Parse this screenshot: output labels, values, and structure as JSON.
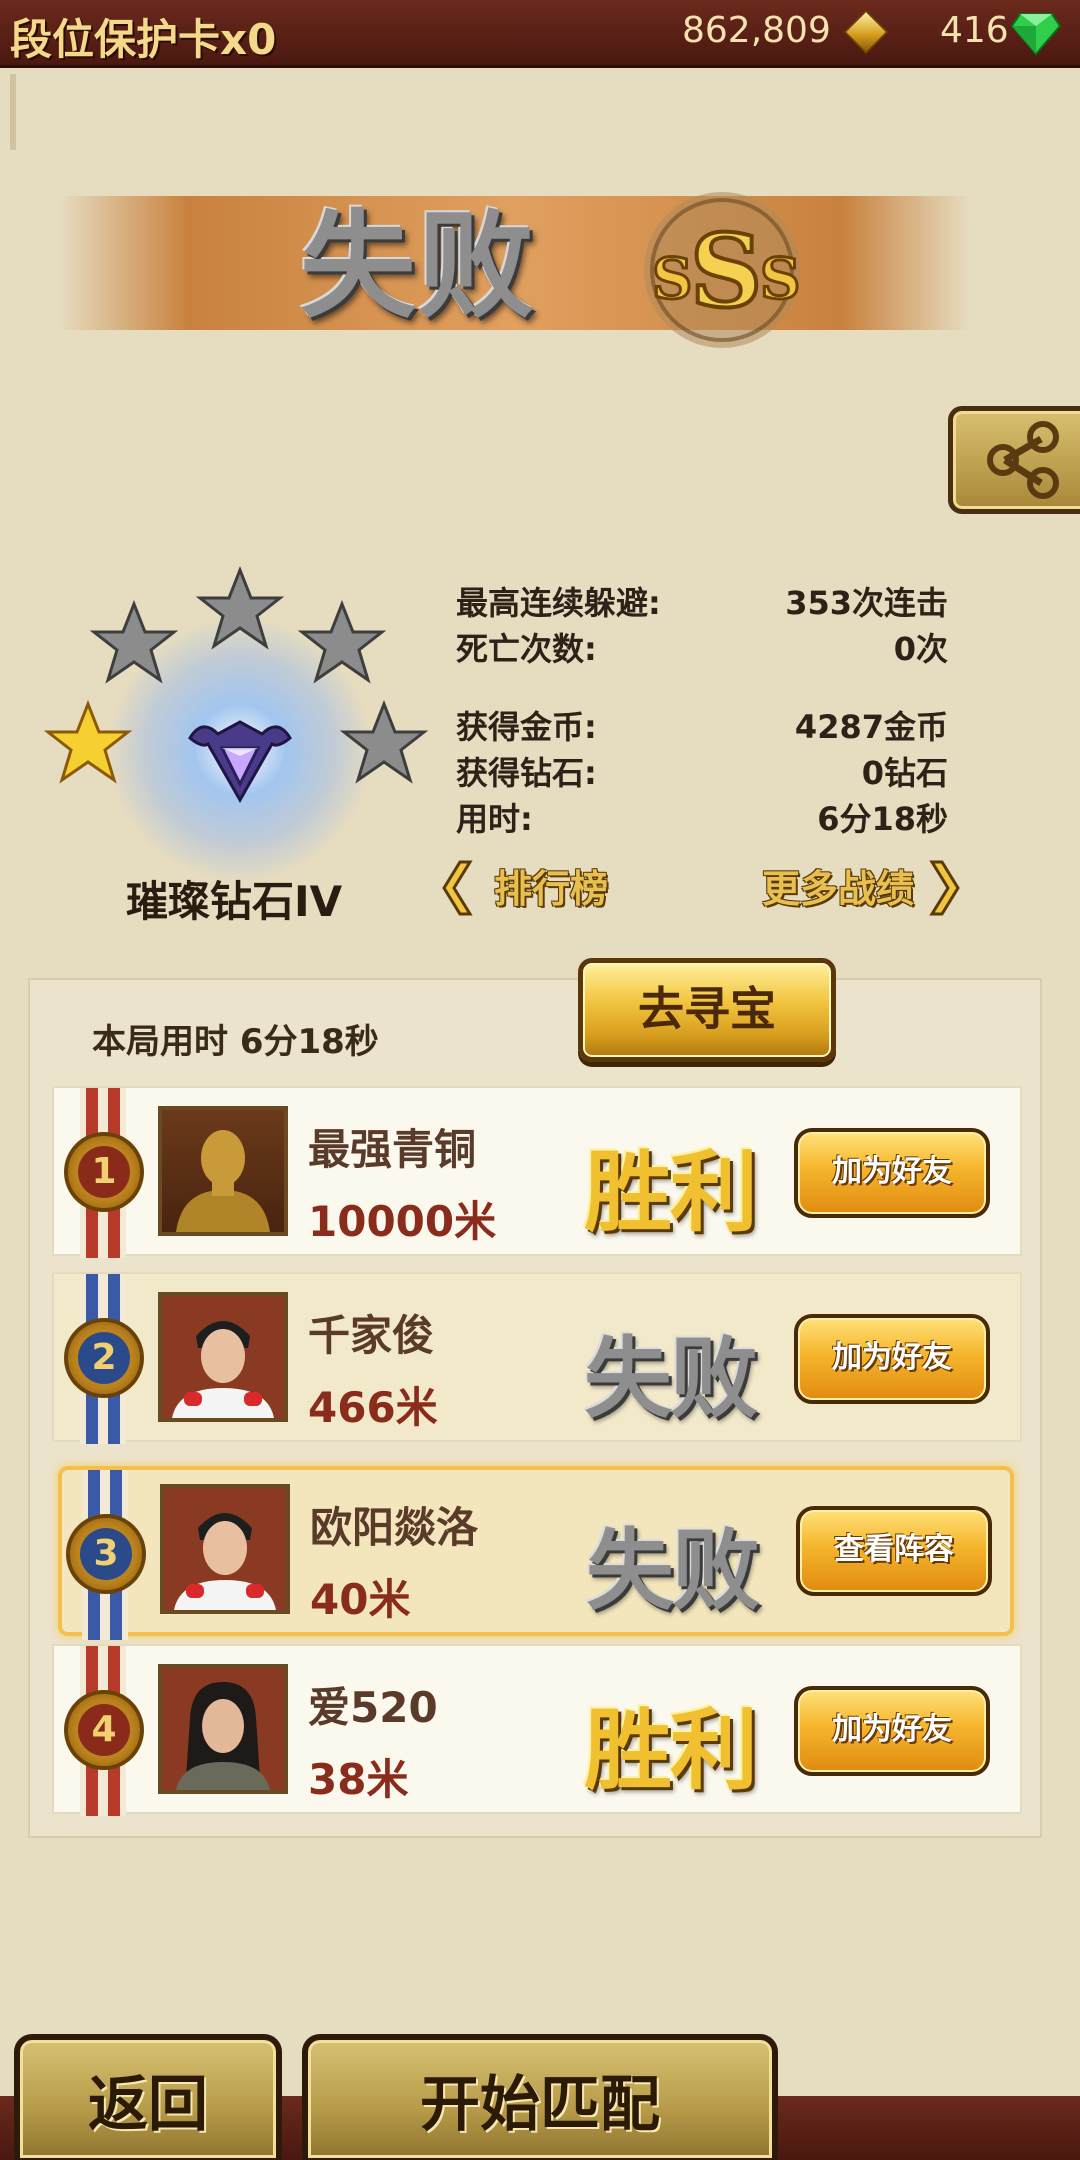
{
  "top_bar": {
    "title": "段位保护卡x0",
    "coins": "862,809",
    "gems": "416"
  },
  "banner": {
    "result": "失败",
    "grade": "SSS"
  },
  "rank": {
    "name": "璀璨钻石IV",
    "stars_filled": 1,
    "stars_total": 5
  },
  "stats": [
    {
      "label": "最高连续躲避:",
      "value": "353次连击"
    },
    {
      "label": "死亡次数:",
      "value": "0次"
    },
    {
      "label": "获得金币:",
      "value": "4287金币"
    },
    {
      "label": "获得钻石:",
      "value": "0钻石"
    },
    {
      "label": "用时:",
      "value": "6分18秒"
    }
  ],
  "links": {
    "leaderboard": "排行榜",
    "more_records": "更多战绩"
  },
  "treasure_button": "去寻宝",
  "round_time": "本局用时  6分18秒",
  "players": [
    {
      "rank": "1",
      "name": "最强青铜",
      "distance": "10000米",
      "outcome": "胜利",
      "action": "加为好友",
      "ribbon": "#b83a2a"
    },
    {
      "rank": "2",
      "name": "千家俊",
      "distance": "466米",
      "outcome": "失败",
      "action": "加为好友",
      "ribbon": "#3a5aa8"
    },
    {
      "rank": "3",
      "name": "欧阳燚洛",
      "distance": "40米",
      "outcome": "失败",
      "action": "查看阵容",
      "ribbon": "#3a5aa8"
    },
    {
      "rank": "4",
      "name": "爱520",
      "distance": "38米",
      "outcome": "胜利",
      "action": "加为好友",
      "ribbon": "#b83a2a"
    }
  ],
  "bottom": {
    "back": "返回",
    "start": "开始匹配"
  },
  "colors": {
    "background": "#e6dcc0",
    "top_bar": "#5a2016",
    "gold": "#f0c030",
    "win": "#f0c030",
    "lose": "#8e8e8e"
  }
}
